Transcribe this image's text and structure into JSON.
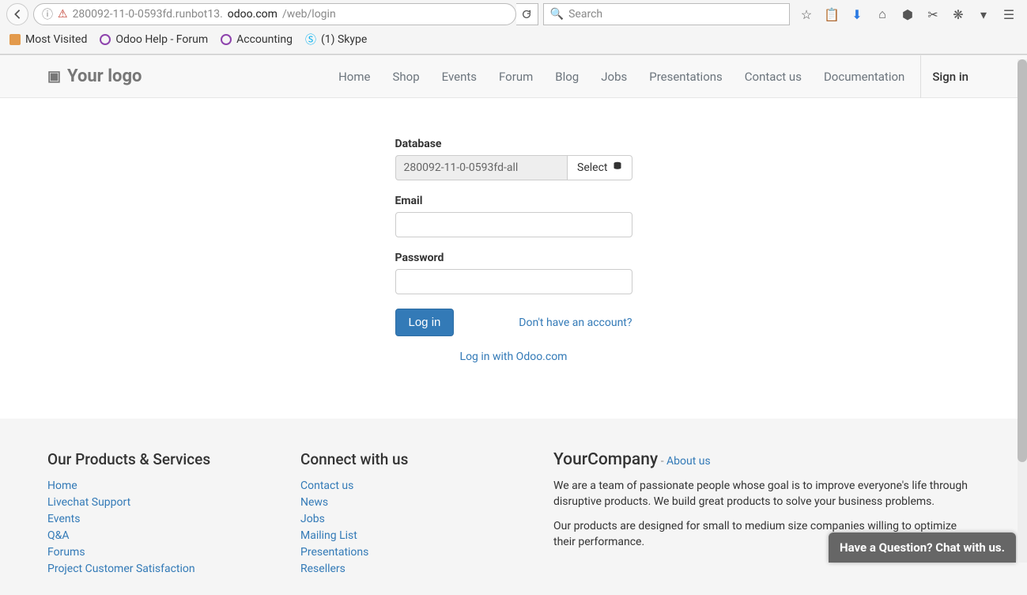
{
  "browser": {
    "url_prefix": "280092-11-0-0593fd.runbot13.",
    "url_domain": "odoo.com",
    "url_path": "/web/login",
    "search_placeholder": "Search",
    "bookmarks": {
      "most_visited": "Most Visited",
      "odoo_help": "Odoo Help - Forum",
      "accounting": "Accounting",
      "skype": "(1) Skype"
    }
  },
  "header": {
    "logo_text": "Your logo",
    "nav": {
      "home": "Home",
      "shop": "Shop",
      "events": "Events",
      "forum": "Forum",
      "blog": "Blog",
      "jobs": "Jobs",
      "presentations": "Presentations",
      "contact": "Contact us",
      "documentation": "Documentation",
      "signin": "Sign in"
    }
  },
  "login": {
    "database_label": "Database",
    "database_value": "280092-11-0-0593fd-all",
    "select_label": "Select",
    "email_label": "Email",
    "password_label": "Password",
    "login_button": "Log in",
    "signup_link": "Don't have an account?",
    "odoo_login_link": "Log in with Odoo.com"
  },
  "footer": {
    "col1_title": "Our Products & Services",
    "col1_links": {
      "home": "Home",
      "livechat": "Livechat Support",
      "events": "Events",
      "qa": "Q&A",
      "forums": "Forums",
      "pcs": "Project Customer Satisfaction"
    },
    "col2_title": "Connect with us",
    "col2_links": {
      "contact": "Contact us",
      "news": "News",
      "jobs": "Jobs",
      "mailing": "Mailing List",
      "presentations": "Presentations",
      "resellers": "Resellers"
    },
    "company_name": "YourCompany",
    "about_sep": " - ",
    "about_link": "About us",
    "para1": "We are a team of passionate people whose goal is to improve everyone's life through disruptive products. We build great products to solve your business problems.",
    "para2": "Our products are designed for small to medium size companies willing to optimize their performance."
  },
  "chat": {
    "text": "Have a Question? Chat with us."
  }
}
